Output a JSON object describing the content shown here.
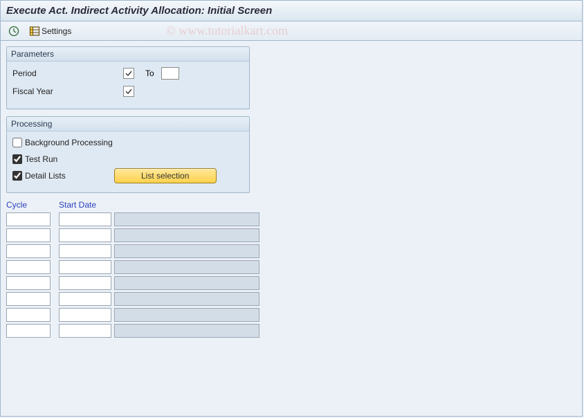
{
  "window": {
    "title": "Execute Act. Indirect Activity Allocation: Initial Screen"
  },
  "toolbar": {
    "execute_label": "",
    "settings_label": "Settings"
  },
  "watermark": "© www.tutorialkart.com",
  "parameters": {
    "title": "Parameters",
    "period_label": "Period",
    "to_label": "To",
    "period_to_value": "",
    "fiscal_year_label": "Fiscal Year"
  },
  "processing": {
    "title": "Processing",
    "background_label": "Background Processing",
    "background_checked": false,
    "testrun_label": "Test Run",
    "testrun_checked": true,
    "detaillists_label": "Detail Lists",
    "detaillists_checked": true,
    "list_selection_label": "List selection"
  },
  "grid": {
    "cycle_header": "Cycle",
    "startdate_header": "Start Date",
    "rows": [
      {
        "cycle": "",
        "startdate": ""
      },
      {
        "cycle": "",
        "startdate": ""
      },
      {
        "cycle": "",
        "startdate": ""
      },
      {
        "cycle": "",
        "startdate": ""
      },
      {
        "cycle": "",
        "startdate": ""
      },
      {
        "cycle": "",
        "startdate": ""
      },
      {
        "cycle": "",
        "startdate": ""
      },
      {
        "cycle": "",
        "startdate": ""
      }
    ]
  }
}
